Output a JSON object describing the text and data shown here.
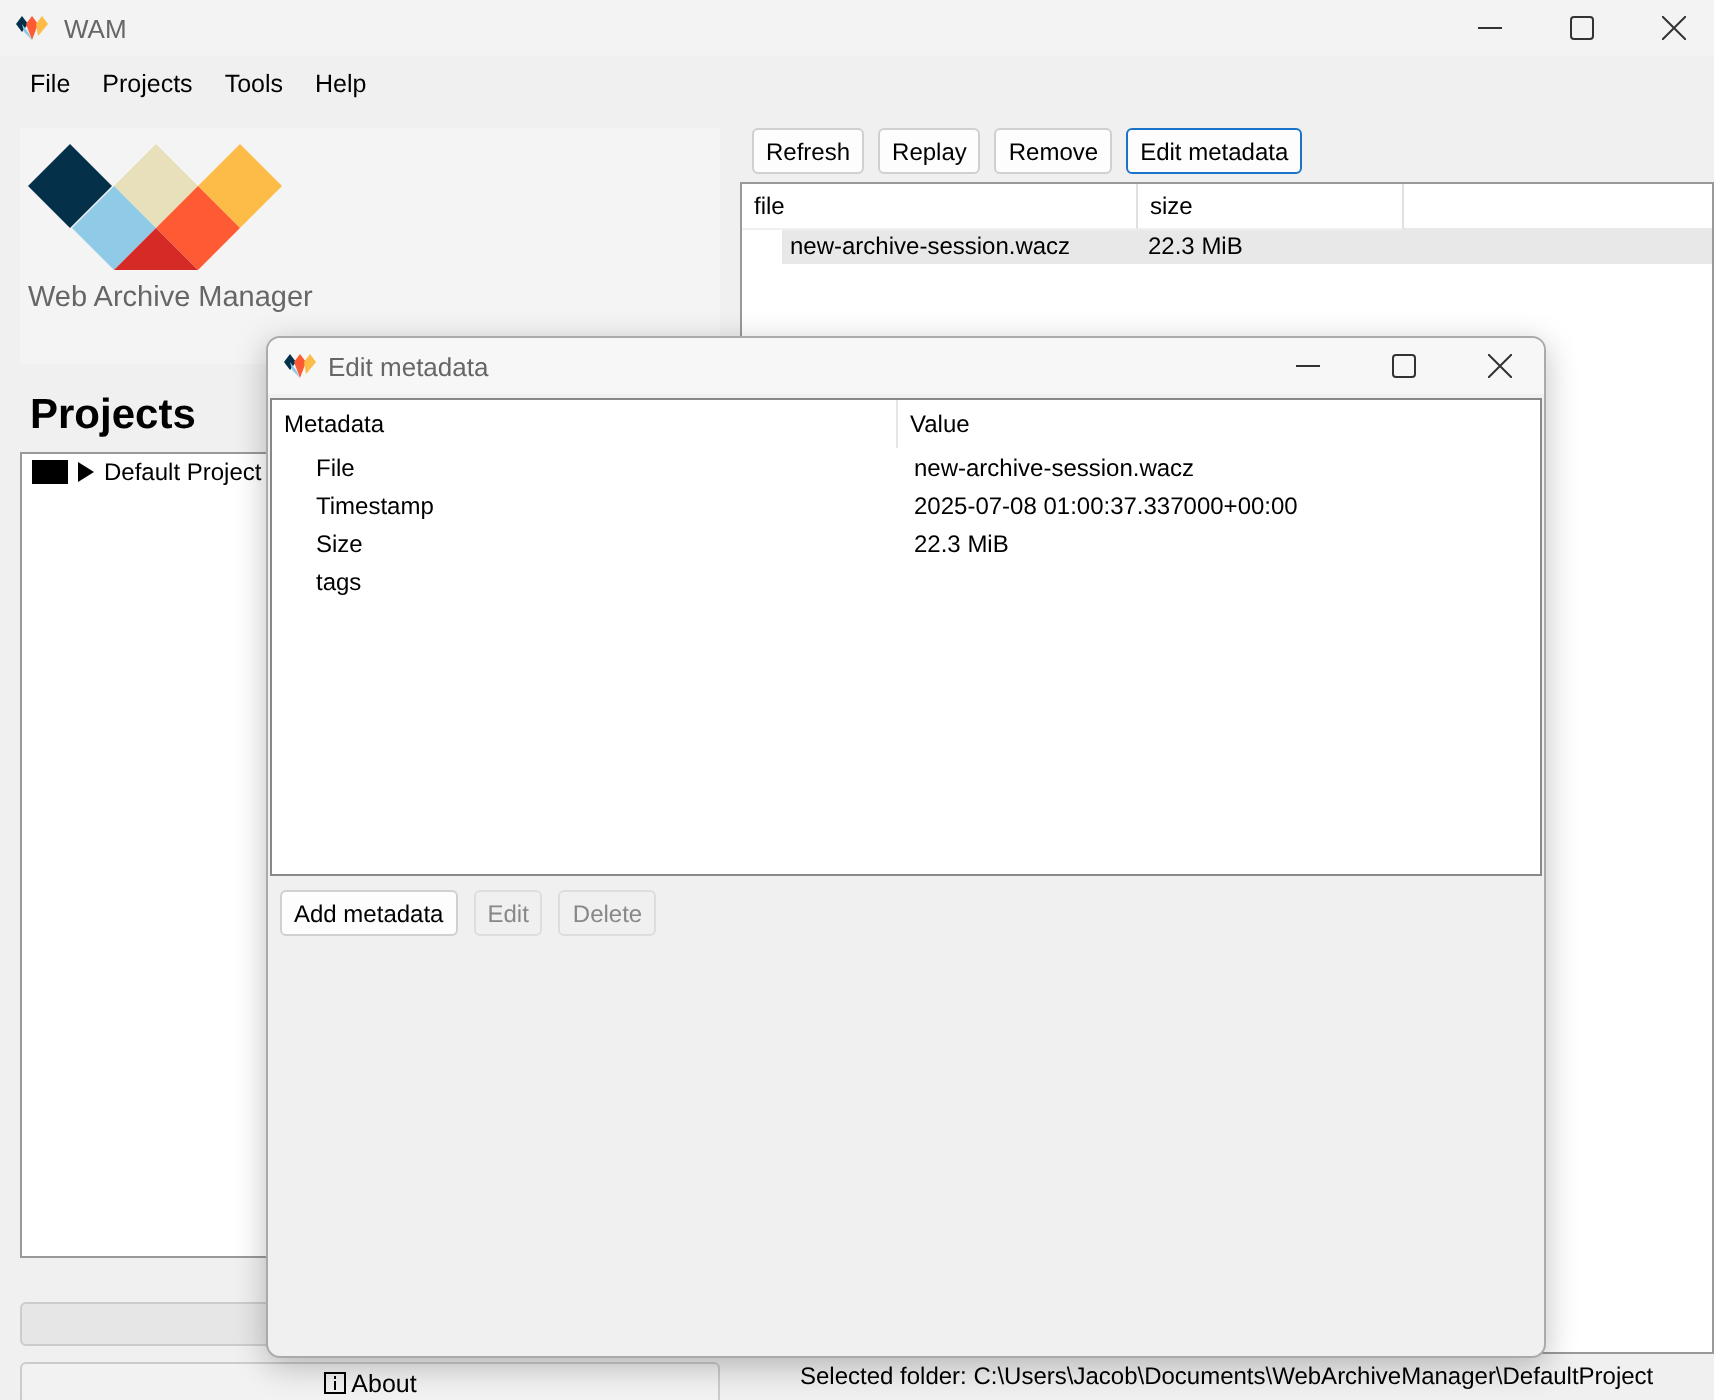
{
  "window": {
    "title": "WAM"
  },
  "menu": [
    "File",
    "Projects",
    "Tools",
    "Help"
  ],
  "sidebar": {
    "app_name": "Web Archive Manager",
    "heading": "Projects",
    "tree": [
      {
        "label": "Default Project",
        "expanded": false
      }
    ],
    "about_button": "About"
  },
  "toolbar": [
    {
      "label": "Refresh",
      "focused": false
    },
    {
      "label": "Replay",
      "focused": false
    },
    {
      "label": "Remove",
      "focused": false
    },
    {
      "label": "Edit metadata",
      "focused": true
    }
  ],
  "table": {
    "columns": [
      "file",
      "size"
    ],
    "rows": [
      {
        "cells": [
          "new-archive-session.wacz",
          "22.3 MiB"
        ],
        "selected": true
      }
    ]
  },
  "status_bar": "Selected folder: C:\\Users\\Jacob\\Documents\\WebArchiveManager\\DefaultProject",
  "dialog": {
    "title": "Edit metadata",
    "columns": [
      "Metadata",
      "Value"
    ],
    "rows": [
      [
        "File",
        "new-archive-session.wacz"
      ],
      [
        "Timestamp",
        "2025-07-08 01:00:37.337000+00:00"
      ],
      [
        "Size",
        "22.3 MiB"
      ],
      [
        "tags",
        ""
      ]
    ],
    "buttons": [
      {
        "label": "Add metadata",
        "disabled": false
      },
      {
        "label": "Edit",
        "disabled": true
      },
      {
        "label": "Delete",
        "disabled": true
      }
    ]
  }
}
